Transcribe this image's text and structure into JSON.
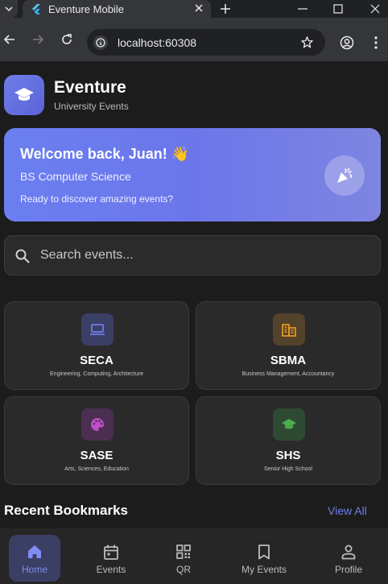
{
  "browser": {
    "tab_title": "Eventure Mobile",
    "url": "localhost:60308"
  },
  "app": {
    "name": "Eventure",
    "subtitle": "University Events"
  },
  "welcome": {
    "title": "Welcome back, Juan! 👋",
    "course": "BS Computer Science",
    "message": "Ready to discover amazing events?"
  },
  "search": {
    "placeholder": "Search events..."
  },
  "colleges": [
    {
      "code": "SECA",
      "description": "Engineering, Computing, Architecture",
      "icon": "laptop-icon",
      "color": "#6f7ee8"
    },
    {
      "code": "SBMA",
      "description": "Business Management, Accountancy",
      "icon": "business-icon",
      "color": "#f0a020"
    },
    {
      "code": "SASE",
      "description": "Arts, Sciences, Education",
      "icon": "palette-icon",
      "color": "#c04fc8"
    },
    {
      "code": "SHS",
      "description": "Senior High School",
      "icon": "school-icon",
      "color": "#4caf50"
    }
  ],
  "bookmarks": {
    "title": "Recent Bookmarks",
    "view_all": "View All"
  },
  "bottom_nav": [
    {
      "label": "Home",
      "icon": "home-icon",
      "active": true
    },
    {
      "label": "Events",
      "icon": "calendar-icon",
      "active": false
    },
    {
      "label": "QR",
      "icon": "qr-code-icon",
      "active": false
    },
    {
      "label": "My Events",
      "icon": "bookmark-icon",
      "active": false
    },
    {
      "label": "Profile",
      "icon": "person-icon",
      "active": false
    }
  ],
  "colors": {
    "accent": "#6f7ee8",
    "background": "#1c1c1c",
    "card": "#2a2a2a"
  }
}
